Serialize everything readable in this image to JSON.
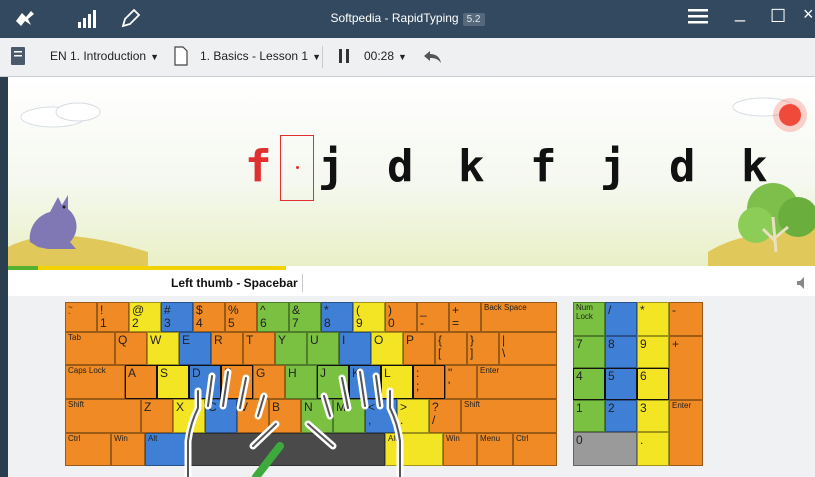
{
  "window": {
    "title": "Softpedia - RapidTyping",
    "version": "5.2",
    "minimize_label": "_",
    "maximize_label": "☐",
    "close_label": "×"
  },
  "toolbar": {
    "course": "EN 1. Introduction",
    "lesson": "1. Basics - Lesson 1",
    "timer": "00:28"
  },
  "lesson": {
    "characters": [
      "f",
      "j",
      "d",
      "k",
      "f",
      "j",
      "d",
      "k"
    ]
  },
  "hint": {
    "text": "Left thumb - Spacebar"
  },
  "progress": {
    "fraction": 0.345
  },
  "colors": {
    "titlebar": "#33495f",
    "typed_error": "#e03030",
    "orange_key": "#f08a24",
    "yellow_key": "#f3e424",
    "blue_key": "#3f7fd6",
    "green_key": "#7ac142"
  },
  "keyboard": {
    "num_row": [
      {
        "top": "~",
        "bot": "`"
      },
      {
        "top": "!",
        "bot": "1"
      },
      {
        "top": "@",
        "bot": "2"
      },
      {
        "top": "#",
        "bot": "3"
      },
      {
        "top": "$",
        "bot": "4"
      },
      {
        "top": "%",
        "bot": "5"
      },
      {
        "top": "^",
        "bot": "6"
      },
      {
        "top": "&",
        "bot": "7"
      },
      {
        "top": "*",
        "bot": "8"
      },
      {
        "top": "(",
        "bot": "9"
      },
      {
        "top": ")",
        "bot": "0"
      },
      {
        "top": "_",
        "bot": "-"
      },
      {
        "top": "+",
        "bot": "="
      }
    ],
    "backspace": "Back Space",
    "tab": "Tab",
    "row_q": [
      "Q",
      "W",
      "E",
      "R",
      "T",
      "Y",
      "U",
      "I",
      "O",
      "P"
    ],
    "row_q_punct": [
      {
        "top": "{",
        "bot": "["
      },
      {
        "top": "}",
        "bot": "]"
      },
      {
        "top": "|",
        "bot": "\\"
      }
    ],
    "caps": "Caps Lock",
    "row_a": [
      "A",
      "S",
      "D",
      "F",
      "G",
      "H",
      "J",
      "K",
      "L"
    ],
    "row_a_punct": [
      {
        "top": ":",
        "bot": ";"
      },
      {
        "top": "\"",
        "bot": "'"
      }
    ],
    "enter": "Enter",
    "shift_left": "Shift",
    "row_z": [
      "Z",
      "X",
      "C",
      "V",
      "B",
      "N",
      "M"
    ],
    "row_z_punct": [
      {
        "top": "<",
        "bot": ","
      },
      {
        "top": ">",
        "bot": "."
      },
      {
        "top": "?",
        "bot": "/"
      }
    ],
    "shift_right": "Shift",
    "ctrl_left": "Ctrl",
    "win_left": "Win",
    "alt_left": "Alt",
    "alt_right": "Alt",
    "win_right": "Win",
    "menu": "Menu",
    "ctrl_right": "Ctrl",
    "numpad": {
      "numlock": "Num Lock",
      "slash": "/",
      "star": "*",
      "minus": "-",
      "plus": "+",
      "enter": "Enter",
      "seven": "7",
      "eight": "8",
      "nine": "9",
      "four": "4",
      "five": "5",
      "six": "6",
      "one": "1",
      "two": "2",
      "three": "3",
      "zero": "0",
      "dot": "."
    }
  }
}
